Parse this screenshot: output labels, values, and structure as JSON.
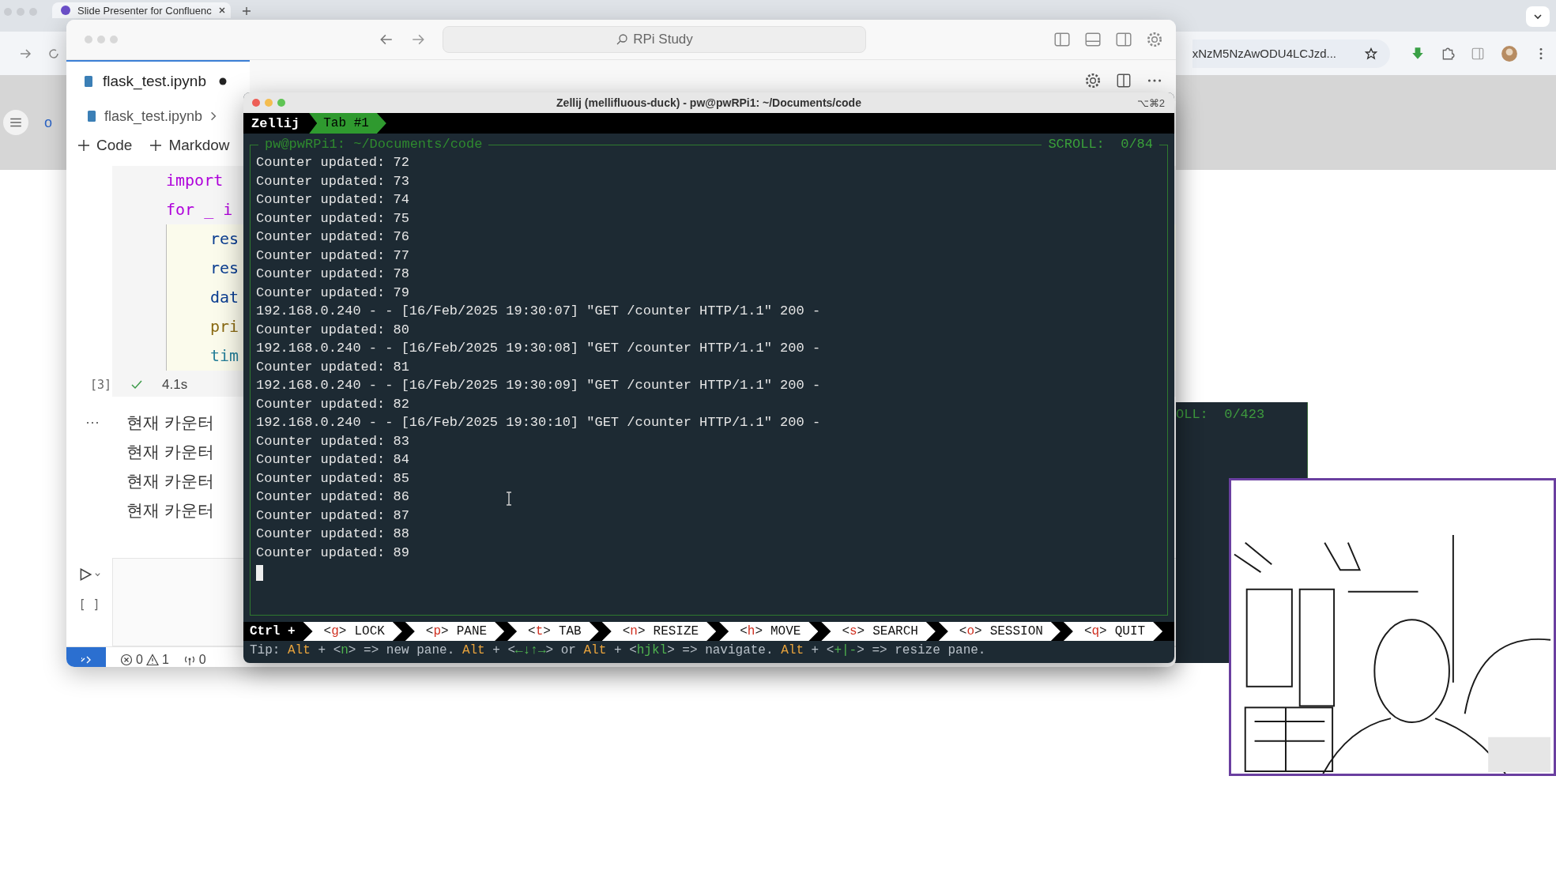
{
  "browser": {
    "tab": {
      "title": "Slide Presenter for Confluenc",
      "selected": true
    },
    "url": "xNzM5NzAwODU4LCJzd...",
    "page_fragment": "o"
  },
  "editor": {
    "search": {
      "placeholder": "RPi Study"
    },
    "tab": {
      "label": "flask_test.ipynb",
      "modified": true
    },
    "breadcrumb": "flask_test.ipynb",
    "toolbar": [
      "Code",
      "Markdow"
    ],
    "code_lines": [
      {
        "text": "import",
        "kind": "keyword"
      },
      {
        "text": "for _ i",
        "kind": "keyword",
        "children": [
          {
            "text": "res",
            "kind": "variable"
          },
          {
            "text": "res",
            "kind": "variable"
          },
          {
            "text": "dat",
            "kind": "variable"
          },
          {
            "text": "pri",
            "kind": "function"
          },
          {
            "text": "tim",
            "kind": "module"
          }
        ]
      }
    ],
    "execution_count": "[3]",
    "succeeded": true,
    "run_time": "4.1s",
    "output_marker": "···",
    "outputs": [
      "현재 카운터",
      "현재 카운터",
      "현재 카운터",
      "현재 카운터"
    ],
    "empty_cell_count": "[ ]",
    "status": {
      "errors": "0",
      "warnings": "1",
      "ports": "0"
    }
  },
  "terminal": {
    "title": "Zellij (mellifluous-duck) - pw@pwRPi1: ~/Documents/code",
    "shortcut": "⌥⌘2",
    "session": "Zellij",
    "tabs": [
      {
        "label": "Tab #1",
        "selected": true
      }
    ],
    "pane_title": "pw@pwRPi1: ~/Documents/code",
    "scroll": "SCROLL:  0/84",
    "lines": [
      "Counter updated: 72",
      "Counter updated: 73",
      "Counter updated: 74",
      "Counter updated: 75",
      "Counter updated: 76",
      "Counter updated: 77",
      "Counter updated: 78",
      "Counter updated: 79",
      "192.168.0.240 - - [16/Feb/2025 19:30:07] \"GET /counter HTTP/1.1\" 200 -",
      "Counter updated: 80",
      "192.168.0.240 - - [16/Feb/2025 19:30:08] \"GET /counter HTTP/1.1\" 200 -",
      "Counter updated: 81",
      "192.168.0.240 - - [16/Feb/2025 19:30:09] \"GET /counter HTTP/1.1\" 200 -",
      "Counter updated: 82",
      "192.168.0.240 - - [16/Feb/2025 19:30:10] \"GET /counter HTTP/1.1\" 200 -",
      "Counter updated: 83",
      "Counter updated: 84",
      "Counter updated: 85",
      "Counter updated: 86",
      "Counter updated: 87",
      "Counter updated: 88",
      "Counter updated: 89"
    ],
    "modifier": "Ctrl +",
    "keys": [
      {
        "open": "<",
        "key": "g",
        "close": ">",
        "label": "LOCK"
      },
      {
        "open": "<",
        "key": "p",
        "close": ">",
        "label": "PANE"
      },
      {
        "open": "<",
        "key": "t",
        "close": ">",
        "label": "TAB"
      },
      {
        "open": "<",
        "key": "n",
        "close": ">",
        "label": "RESIZE"
      },
      {
        "open": "<",
        "key": "h",
        "close": ">",
        "label": "MOVE"
      },
      {
        "open": "<",
        "key": "s",
        "close": ">",
        "label": "SEARCH"
      },
      {
        "open": "<",
        "key": "o",
        "close": ">",
        "label": "SESSION"
      },
      {
        "open": "<",
        "key": "q",
        "close": ">",
        "label": "QUIT"
      }
    ],
    "tip": [
      {
        "text": "Tip: ",
        "kind": "plain"
      },
      {
        "text": "Alt",
        "kind": "modifier"
      },
      {
        "text": " + <",
        "kind": "plain"
      },
      {
        "text": "n",
        "kind": "key"
      },
      {
        "text": "> => new pane. ",
        "kind": "plain"
      },
      {
        "text": "Alt",
        "kind": "modifier"
      },
      {
        "text": " + <",
        "kind": "plain"
      },
      {
        "text": "←↓↑→",
        "kind": "key"
      },
      {
        "text": "> or ",
        "kind": "plain"
      },
      {
        "text": "Alt",
        "kind": "modifier"
      },
      {
        "text": " + <",
        "kind": "plain"
      },
      {
        "text": "hjkl",
        "kind": "key"
      },
      {
        "text": "> => navigate. ",
        "kind": "plain"
      },
      {
        "text": "Alt",
        "kind": "modifier"
      },
      {
        "text": " + <",
        "kind": "plain"
      },
      {
        "text": "+|-",
        "kind": "key"
      },
      {
        "text": "> => resize pane.",
        "kind": "plain"
      }
    ]
  },
  "background_terminal": {
    "scroll": "OLL:  0/423"
  }
}
